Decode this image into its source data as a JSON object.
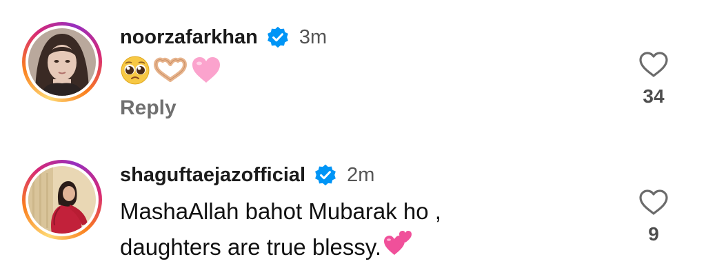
{
  "comments": [
    {
      "username": "noorzafarkhan",
      "verified": true,
      "time": "3m",
      "text": "",
      "emojis": [
        "pleading-face-emoji",
        "heart-hands-emoji",
        "pink-heart-emoji"
      ],
      "reply_label": "Reply",
      "likes": "34"
    },
    {
      "username": "shaguftaejazofficial",
      "verified": true,
      "time": "2m",
      "text_line1": "MashaAllah bahot Mubarak ho ,",
      "text_line2": "daughters are true blessy.",
      "emojis": [
        "two-hearts-emoji"
      ],
      "likes": "9"
    }
  ],
  "colors": {
    "verified_blue": "#0095f6",
    "username": "#1b1b1b",
    "muted": "#707070"
  }
}
